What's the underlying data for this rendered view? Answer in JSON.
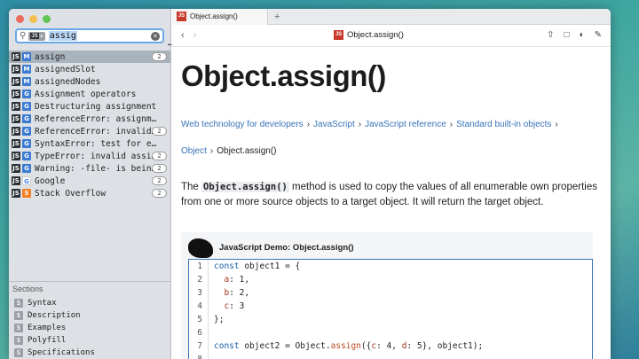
{
  "sidebar": {
    "search": {
      "doc_chip": "JS",
      "query": "assig"
    },
    "results": [
      {
        "icon": "JS",
        "type": "M",
        "text": "assign",
        "badge": "2",
        "selected": true
      },
      {
        "icon": "JS",
        "type": "M",
        "text": "assignedSlot",
        "badge": ""
      },
      {
        "icon": "JS",
        "type": "M",
        "text": "assignedNodes",
        "badge": ""
      },
      {
        "icon": "JS",
        "type": "G",
        "text": "Assignment operators",
        "badge": ""
      },
      {
        "icon": "JS",
        "type": "G",
        "text": "Destructuring assignment",
        "badge": ""
      },
      {
        "icon": "JS",
        "type": "G",
        "text": "ReferenceError: assignmen…",
        "badge": ""
      },
      {
        "icon": "JS",
        "type": "G",
        "text": "ReferenceError: invalid a…",
        "badge": "2"
      },
      {
        "icon": "JS",
        "type": "G",
        "text": "SyntaxError: test for equ…",
        "badge": ""
      },
      {
        "icon": "JS",
        "type": "G",
        "text": "TypeError: invalid assign…",
        "badge": "2"
      },
      {
        "icon": "JS",
        "type": "G",
        "text": "Warning: -file- is being…",
        "badge": "2"
      },
      {
        "icon": "JS",
        "type": "google",
        "text": "Google",
        "badge": "2"
      },
      {
        "icon": "JS",
        "type": "so",
        "text": "Stack Overflow",
        "badge": "2"
      }
    ],
    "sections_title": "Sections",
    "sections": [
      "Syntax",
      "Description",
      "Examples",
      "Polyfill",
      "Specifications"
    ]
  },
  "tab": {
    "badge": "JS",
    "title": "Object.assign()",
    "add": "+"
  },
  "toolbar": {
    "back": "‹",
    "forward": "›",
    "title_badge": "JS",
    "title": "Object.assign()"
  },
  "page": {
    "heading": "Object.assign()",
    "breadcrumbs": [
      "Web technology for developers",
      "JavaScript",
      "JavaScript reference",
      "Standard built-in objects"
    ],
    "sub_crumb_link": "Object",
    "sub_crumb_current": "Object.assign()",
    "intro_before": "The ",
    "intro_code": "Object.assign()",
    "intro_after": " method is used to copy the values of all enumerable own properties from one or more source objects to a target object. It will return the target object.",
    "demo_title": "JavaScript Demo: Object.assign()"
  },
  "code_lines": [
    {
      "n": "1",
      "html": "<span class=\"kw\">const</span> object1 = {"
    },
    {
      "n": "2",
      "html": "  <span class=\"prop\">a</span>: 1,"
    },
    {
      "n": "3",
      "html": "  <span class=\"prop\">b</span>: 2,"
    },
    {
      "n": "4",
      "html": "  <span class=\"prop\">c</span>: 3"
    },
    {
      "n": "5",
      "html": "};"
    },
    {
      "n": "6",
      "html": ""
    },
    {
      "n": "7",
      "html": "<span class=\"kw\">const</span> object2 = Object.<span class=\"fn\">assign</span>({<span class=\"prop\">c</span>: 4, <span class=\"prop\">d</span>: 5}, object1);"
    },
    {
      "n": "8",
      "html": ""
    }
  ]
}
